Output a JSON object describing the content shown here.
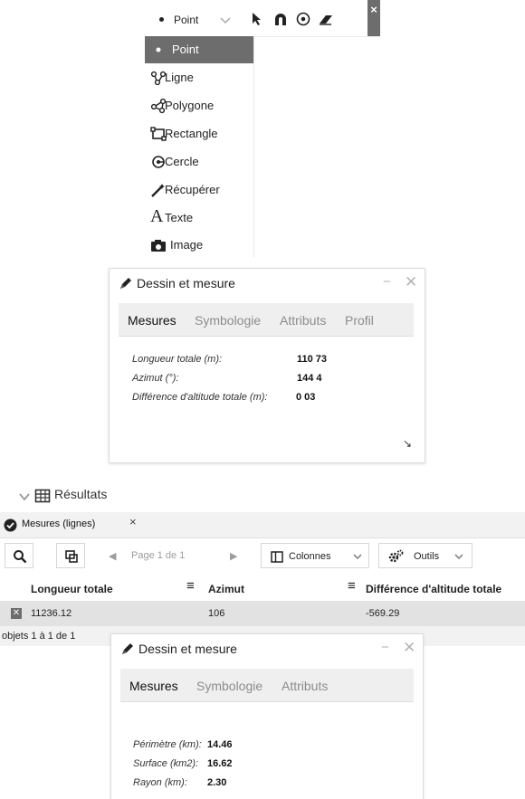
{
  "toolbar": {
    "selected_geometry": "Point",
    "tools": [
      "cursor-arrow-icon",
      "magnet-icon",
      "target-icon",
      "eraser-icon"
    ],
    "close_label": "×"
  },
  "geometry_menu": {
    "items": [
      {
        "label": "Point",
        "icon": "point-icon",
        "selected": true
      },
      {
        "label": "Ligne",
        "icon": "line-icon"
      },
      {
        "label": "Polygone",
        "icon": "polygon-icon"
      },
      {
        "label": "Rectangle",
        "icon": "rectangle-icon"
      },
      {
        "label": "Cercle",
        "icon": "circle-icon"
      },
      {
        "label": "Récupérer",
        "icon": "magic-wand-icon"
      },
      {
        "label": "Texte",
        "icon": "text-icon"
      },
      {
        "label": "Image",
        "icon": "camera-icon"
      }
    ]
  },
  "panel_top": {
    "title": "Dessin et mesure",
    "minimize": "−",
    "close": "✕",
    "tabs": [
      "Mesures",
      "Symbologie",
      "Attributs",
      "Profil"
    ],
    "active_tab": "Mesures",
    "measures": [
      {
        "label": "Longueur totale (m):",
        "value": "110 73"
      },
      {
        "label": "Azimut (°):",
        "value": "144 4"
      },
      {
        "label": "Différence d'altitude totale (m):",
        "value": "0 03"
      }
    ],
    "resize_icon": "↘"
  },
  "results": {
    "title": "Résultats",
    "tab_label": "Mesures (lignes)",
    "tab_close": "×",
    "pager_text": "Page 1 de 1",
    "columns_button": "Colonnes",
    "tools_button": "Outils",
    "columns": [
      "Longueur totale",
      "Azimut",
      "Différence d'altitude totale"
    ],
    "rows": [
      {
        "longueur": "11236.12",
        "azimut": "106",
        "difference": "-569.29"
      }
    ],
    "footer": "objets 1 à 1 de 1"
  },
  "panel_bottom": {
    "title": "Dessin et mesure",
    "minimize": "−",
    "close": "✕",
    "tabs": [
      "Mesures",
      "Symbologie",
      "Attributs"
    ],
    "active_tab": "Mesures",
    "measures": [
      {
        "label": "Périmètre (km):",
        "value": "14.46"
      },
      {
        "label": "Surface (km2):",
        "value": "16.62"
      },
      {
        "label": "Rayon (km):",
        "value": "2.30"
      }
    ]
  },
  "colors": {
    "selected_bg": "#6d6d6d",
    "tab_bar": "#efefef",
    "row_bg": "#e2e2e2"
  }
}
